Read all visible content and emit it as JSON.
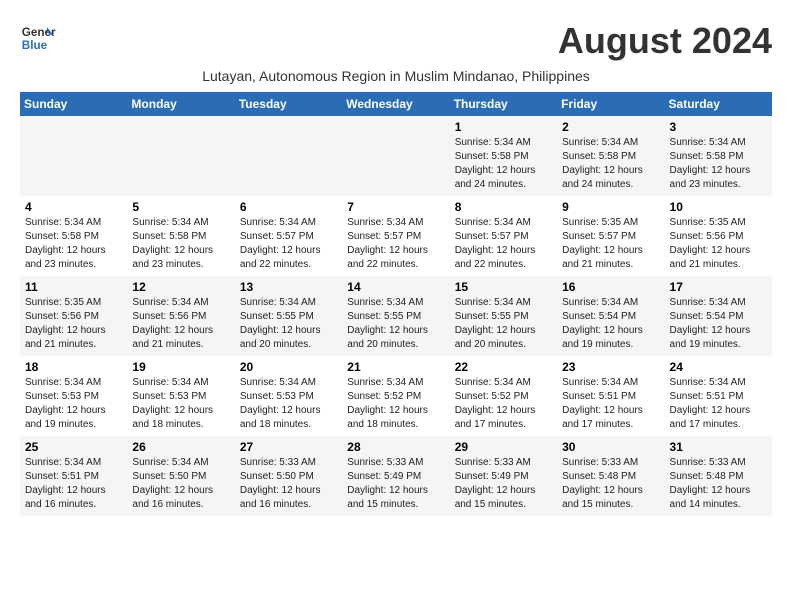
{
  "logo": {
    "line1": "General",
    "line2": "Blue"
  },
  "title": "August 2024",
  "subtitle": "Lutayan, Autonomous Region in Muslim Mindanao, Philippines",
  "days_of_week": [
    "Sunday",
    "Monday",
    "Tuesday",
    "Wednesday",
    "Thursday",
    "Friday",
    "Saturday"
  ],
  "weeks": [
    [
      {
        "day": "",
        "text": ""
      },
      {
        "day": "",
        "text": ""
      },
      {
        "day": "",
        "text": ""
      },
      {
        "day": "",
        "text": ""
      },
      {
        "day": "1",
        "text": "Sunrise: 5:34 AM\nSunset: 5:58 PM\nDaylight: 12 hours\nand 24 minutes."
      },
      {
        "day": "2",
        "text": "Sunrise: 5:34 AM\nSunset: 5:58 PM\nDaylight: 12 hours\nand 24 minutes."
      },
      {
        "day": "3",
        "text": "Sunrise: 5:34 AM\nSunset: 5:58 PM\nDaylight: 12 hours\nand 23 minutes."
      }
    ],
    [
      {
        "day": "4",
        "text": "Sunrise: 5:34 AM\nSunset: 5:58 PM\nDaylight: 12 hours\nand 23 minutes."
      },
      {
        "day": "5",
        "text": "Sunrise: 5:34 AM\nSunset: 5:58 PM\nDaylight: 12 hours\nand 23 minutes."
      },
      {
        "day": "6",
        "text": "Sunrise: 5:34 AM\nSunset: 5:57 PM\nDaylight: 12 hours\nand 22 minutes."
      },
      {
        "day": "7",
        "text": "Sunrise: 5:34 AM\nSunset: 5:57 PM\nDaylight: 12 hours\nand 22 minutes."
      },
      {
        "day": "8",
        "text": "Sunrise: 5:34 AM\nSunset: 5:57 PM\nDaylight: 12 hours\nand 22 minutes."
      },
      {
        "day": "9",
        "text": "Sunrise: 5:35 AM\nSunset: 5:57 PM\nDaylight: 12 hours\nand 21 minutes."
      },
      {
        "day": "10",
        "text": "Sunrise: 5:35 AM\nSunset: 5:56 PM\nDaylight: 12 hours\nand 21 minutes."
      }
    ],
    [
      {
        "day": "11",
        "text": "Sunrise: 5:35 AM\nSunset: 5:56 PM\nDaylight: 12 hours\nand 21 minutes."
      },
      {
        "day": "12",
        "text": "Sunrise: 5:34 AM\nSunset: 5:56 PM\nDaylight: 12 hours\nand 21 minutes."
      },
      {
        "day": "13",
        "text": "Sunrise: 5:34 AM\nSunset: 5:55 PM\nDaylight: 12 hours\nand 20 minutes."
      },
      {
        "day": "14",
        "text": "Sunrise: 5:34 AM\nSunset: 5:55 PM\nDaylight: 12 hours\nand 20 minutes."
      },
      {
        "day": "15",
        "text": "Sunrise: 5:34 AM\nSunset: 5:55 PM\nDaylight: 12 hours\nand 20 minutes."
      },
      {
        "day": "16",
        "text": "Sunrise: 5:34 AM\nSunset: 5:54 PM\nDaylight: 12 hours\nand 19 minutes."
      },
      {
        "day": "17",
        "text": "Sunrise: 5:34 AM\nSunset: 5:54 PM\nDaylight: 12 hours\nand 19 minutes."
      }
    ],
    [
      {
        "day": "18",
        "text": "Sunrise: 5:34 AM\nSunset: 5:53 PM\nDaylight: 12 hours\nand 19 minutes."
      },
      {
        "day": "19",
        "text": "Sunrise: 5:34 AM\nSunset: 5:53 PM\nDaylight: 12 hours\nand 18 minutes."
      },
      {
        "day": "20",
        "text": "Sunrise: 5:34 AM\nSunset: 5:53 PM\nDaylight: 12 hours\nand 18 minutes."
      },
      {
        "day": "21",
        "text": "Sunrise: 5:34 AM\nSunset: 5:52 PM\nDaylight: 12 hours\nand 18 minutes."
      },
      {
        "day": "22",
        "text": "Sunrise: 5:34 AM\nSunset: 5:52 PM\nDaylight: 12 hours\nand 17 minutes."
      },
      {
        "day": "23",
        "text": "Sunrise: 5:34 AM\nSunset: 5:51 PM\nDaylight: 12 hours\nand 17 minutes."
      },
      {
        "day": "24",
        "text": "Sunrise: 5:34 AM\nSunset: 5:51 PM\nDaylight: 12 hours\nand 17 minutes."
      }
    ],
    [
      {
        "day": "25",
        "text": "Sunrise: 5:34 AM\nSunset: 5:51 PM\nDaylight: 12 hours\nand 16 minutes."
      },
      {
        "day": "26",
        "text": "Sunrise: 5:34 AM\nSunset: 5:50 PM\nDaylight: 12 hours\nand 16 minutes."
      },
      {
        "day": "27",
        "text": "Sunrise: 5:33 AM\nSunset: 5:50 PM\nDaylight: 12 hours\nand 16 minutes."
      },
      {
        "day": "28",
        "text": "Sunrise: 5:33 AM\nSunset: 5:49 PM\nDaylight: 12 hours\nand 15 minutes."
      },
      {
        "day": "29",
        "text": "Sunrise: 5:33 AM\nSunset: 5:49 PM\nDaylight: 12 hours\nand 15 minutes."
      },
      {
        "day": "30",
        "text": "Sunrise: 5:33 AM\nSunset: 5:48 PM\nDaylight: 12 hours\nand 15 minutes."
      },
      {
        "day": "31",
        "text": "Sunrise: 5:33 AM\nSunset: 5:48 PM\nDaylight: 12 hours\nand 14 minutes."
      }
    ]
  ]
}
